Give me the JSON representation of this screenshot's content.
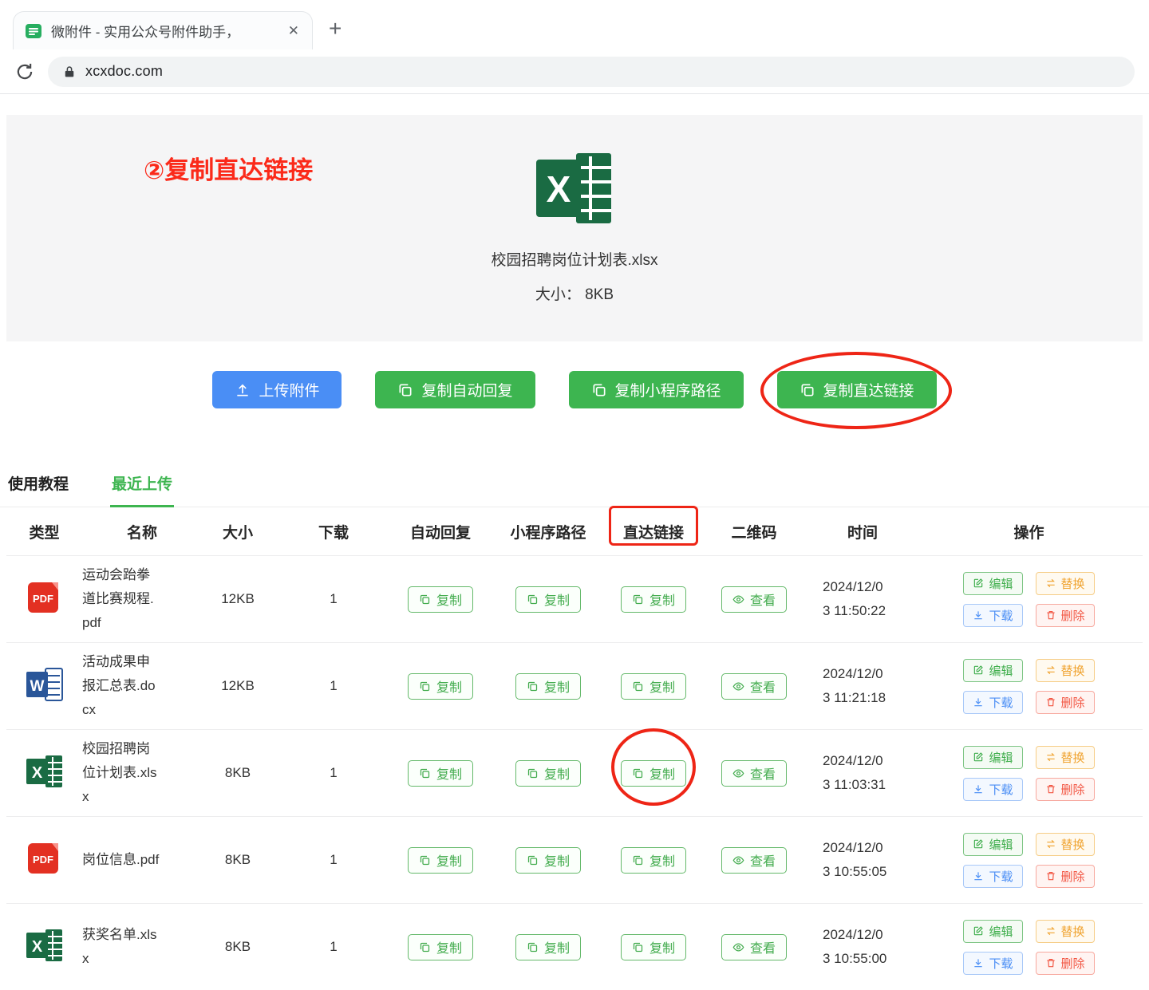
{
  "browser": {
    "tab_title": "微附件 - 实用公众号附件助手，",
    "close_tab": "✕",
    "new_tab": "+",
    "url": "xcxdoc.com"
  },
  "annotations": {
    "step_label": "②复制直达链接"
  },
  "file_preview": {
    "name": "校园招聘岗位计划表.xlsx",
    "size": "大小： 8KB"
  },
  "toolbar": {
    "upload": "上传附件",
    "copy_auto_reply": "复制自动回复",
    "copy_mp_path": "复制小程序路径",
    "copy_direct_link": "复制直达链接"
  },
  "section_tabs": {
    "usage": "使用教程",
    "recent": "最近上传"
  },
  "icons": {
    "excel_letter": "X",
    "word_letter": "W",
    "pdf_label": "PDF"
  },
  "table": {
    "headers": [
      "类型",
      "名称",
      "大小",
      "下载",
      "自动回复",
      "小程序路径",
      "直达链接",
      "二维码",
      "时间",
      "操作"
    ],
    "copy_label": "复制",
    "view_label": "查看",
    "actions": {
      "edit": "编辑",
      "replace": "替换",
      "download": "下载",
      "delete": "删除"
    },
    "rows": [
      {
        "type": "pdf",
        "name": "运动会跆拳道比赛规程.pdf",
        "size": "12KB",
        "downloads": "1",
        "time": "2024/12/03 11:50:22"
      },
      {
        "type": "word",
        "name": "活动成果申报汇总表.docx",
        "size": "12KB",
        "downloads": "1",
        "time": "2024/12/03 11:21:18"
      },
      {
        "type": "excel",
        "name": "校园招聘岗位计划表.xlsx",
        "size": "8KB",
        "downloads": "1",
        "time": "2024/12/03 11:03:31"
      },
      {
        "type": "pdf",
        "name": "岗位信息.pdf",
        "size": "8KB",
        "downloads": "1",
        "time": "2024/12/03 10:55:05"
      },
      {
        "type": "excel",
        "name": "获奖名单.xlsx",
        "size": "8KB",
        "downloads": "1",
        "time": "2024/12/03 10:55:00"
      }
    ]
  },
  "colors": {
    "primary_green": "#3db550",
    "primary_blue": "#4a8ef5",
    "annotation_red": "#ee2516",
    "warn_orange": "#f0a32f",
    "danger_red": "#f25643",
    "excel_green": "#1a6b43",
    "word_blue": "#2a5699",
    "pdf_red": "#e33022"
  }
}
